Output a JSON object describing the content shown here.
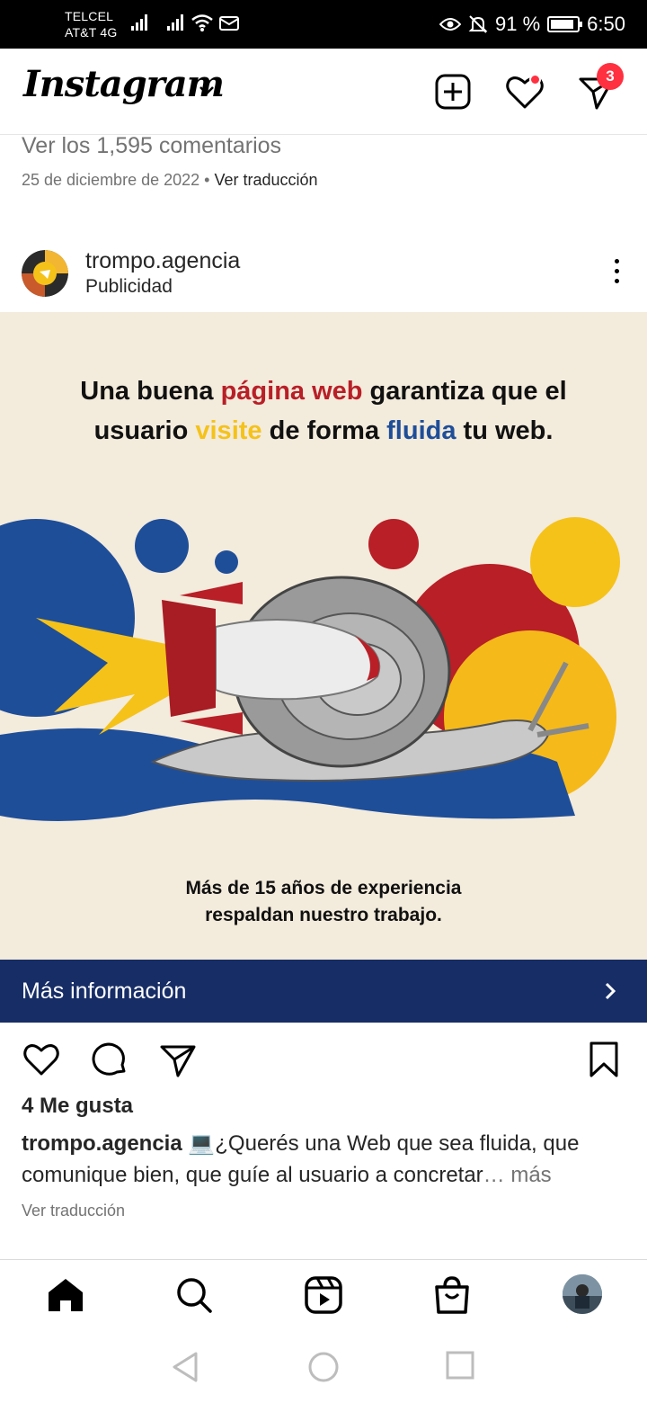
{
  "status_bar": {
    "carrier_1": "TELCEL",
    "carrier_2": "AT&T 4G",
    "battery": "91 %",
    "time": "6:50",
    "battery_level": 0.91
  },
  "header": {
    "logo": "Instagram",
    "activity_badge": "3"
  },
  "previous_post": {
    "view_comments": "Ver los 1,595 comentarios",
    "date": "25 de diciembre de 2022",
    "separator": "•",
    "see_translation": "Ver traducción"
  },
  "post": {
    "username": "trompo.agencia",
    "sponsored_label": "Publicidad",
    "ad": {
      "headline_1a": "Una buena ",
      "headline_1b": "página web",
      "headline_1c": " garantiza que el",
      "headline_2a": "usuario ",
      "headline_2b": "visite",
      "headline_2c": " de forma ",
      "headline_2d": "fluida",
      "headline_2e": " tu web.",
      "tagline_1": "Más de 15 años de experiencia",
      "tagline_2": "respaldan nuestro trabajo."
    },
    "cta_label": "Más información",
    "likes": "4 Me gusta",
    "caption_user": "trompo.agencia",
    "caption_emoji": "💻",
    "caption_text": "¿Querés una Web que sea fluida, que comunique bien, que guíe al usuario a concretar",
    "caption_more": "… más",
    "see_translation": "Ver traducción"
  },
  "icons": [
    "wifi-icon",
    "mail-icon",
    "eye-icon",
    "bell-off-icon",
    "chevron-down-icon",
    "new-post-icon",
    "heart-icon",
    "direct-icon",
    "more-icon",
    "comment-icon",
    "share-icon",
    "bookmark-icon",
    "home-icon",
    "search-icon",
    "reels-icon",
    "shop-icon",
    "back-icon",
    "home-circle-icon",
    "recents-icon"
  ],
  "colors": {
    "cta_bg": "#172d66",
    "badge": "#ff3040",
    "red": "#b81f27",
    "yellow": "#f5c21a",
    "blue": "#1f4e99",
    "ad_bg": "#f3ebdc"
  }
}
